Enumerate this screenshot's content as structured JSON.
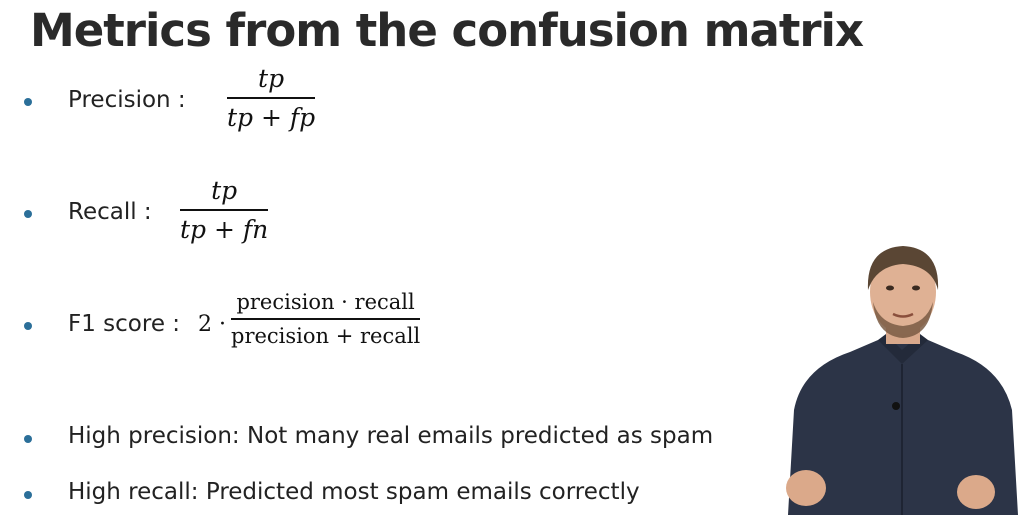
{
  "slide": {
    "title": "Metrics from the confusion matrix"
  },
  "metrics": [
    {
      "label": "Precision :",
      "numerator": "tp",
      "denominator": "tp + fp"
    },
    {
      "label": "Recall :",
      "numerator": "tp",
      "denominator": "tp + fn"
    },
    {
      "label": "F1 score :",
      "coefficient": "2 ·",
      "numerator": "precision · recall",
      "denominator": "precision + recall"
    }
  ],
  "notes": [
    "High precision: Not many real emails predicted as spam",
    "High recall: Predicted most spam emails correctly"
  ],
  "colors": {
    "bullet": "#2b6f99",
    "title": "#2a2a2a",
    "shirt": "#2c3447"
  },
  "presenter": {
    "icon": "presenter-video-image"
  }
}
